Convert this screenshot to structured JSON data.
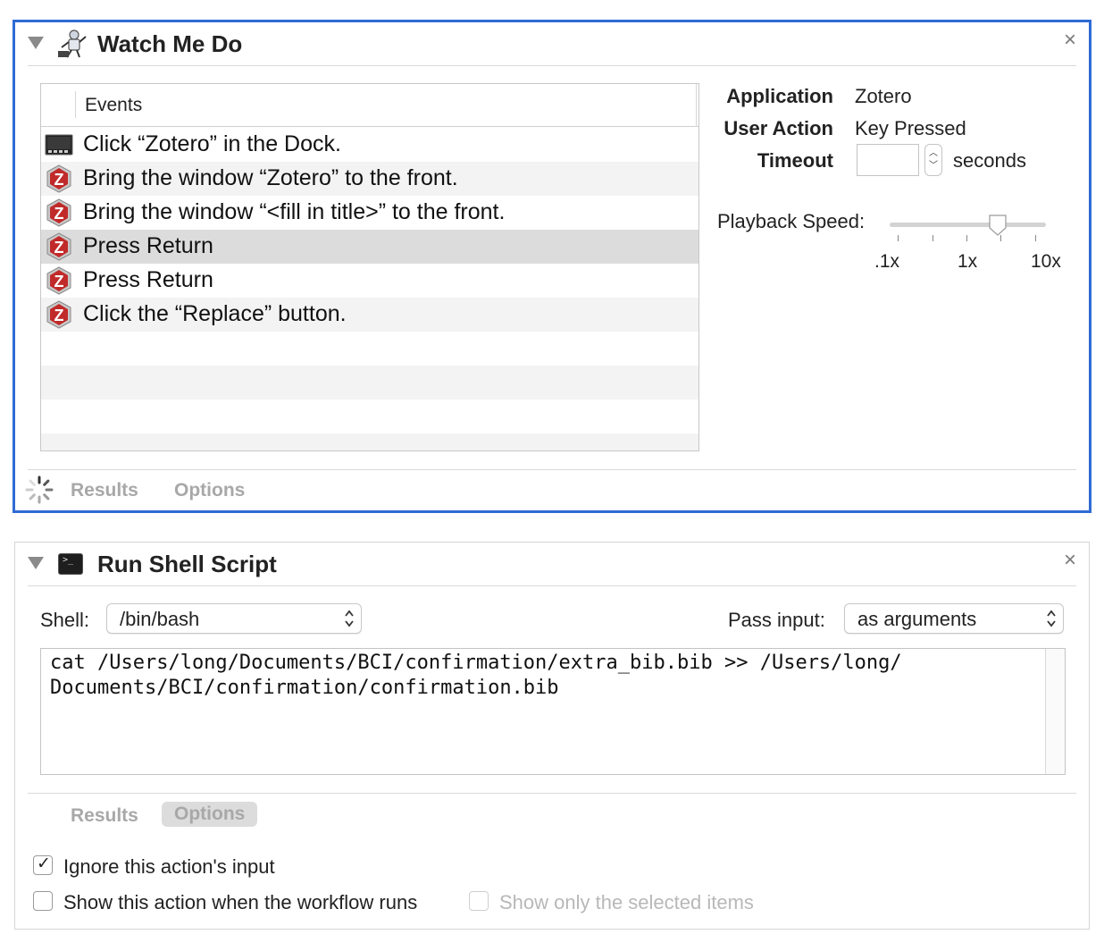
{
  "watch": {
    "title": "Watch Me Do",
    "close": "×",
    "events_header": "Events",
    "events": [
      {
        "icon": "dock-icon",
        "text": "Click “Zotero” in the Dock."
      },
      {
        "icon": "zotero-icon",
        "text": "Bring the window “Zotero” to the front."
      },
      {
        "icon": "zotero-icon",
        "text": "Bring the window “<fill in title>” to the front."
      },
      {
        "icon": "zotero-icon",
        "text": "Press Return",
        "selected": true
      },
      {
        "icon": "zotero-icon",
        "text": "Press Return"
      },
      {
        "icon": "zotero-icon",
        "text": "Click the “Replace” button."
      }
    ],
    "application_label": "Application",
    "application_value": "Zotero",
    "user_action_label": "User Action",
    "user_action_value": "Key Pressed",
    "timeout_label": "Timeout",
    "timeout_value": "",
    "timeout_unit": "seconds",
    "playback_label": "Playback Speed:",
    "speed_min": ".1x",
    "speed_mid": "1x",
    "speed_max": "10x",
    "tabs": {
      "results": "Results",
      "options": "Options"
    }
  },
  "shell": {
    "title": "Run Shell Script",
    "close": "×",
    "shell_label": "Shell:",
    "shell_value": "/bin/bash",
    "pass_label": "Pass input:",
    "pass_value": "as arguments",
    "script": "cat /Users/long/Documents/BCI/confirmation/extra_bib.bib >> /Users/long/\nDocuments/BCI/confirmation/confirmation.bib",
    "tabs": {
      "results": "Results",
      "options": "Options"
    },
    "ignore_input": "Ignore this action's input",
    "ignore_input_checked": true,
    "show_action": "Show this action when the workflow runs",
    "show_action_checked": false,
    "show_selected": "Show only the selected items",
    "show_selected_checked": false
  },
  "colors": {
    "focus_border": "#2f6bd4"
  }
}
